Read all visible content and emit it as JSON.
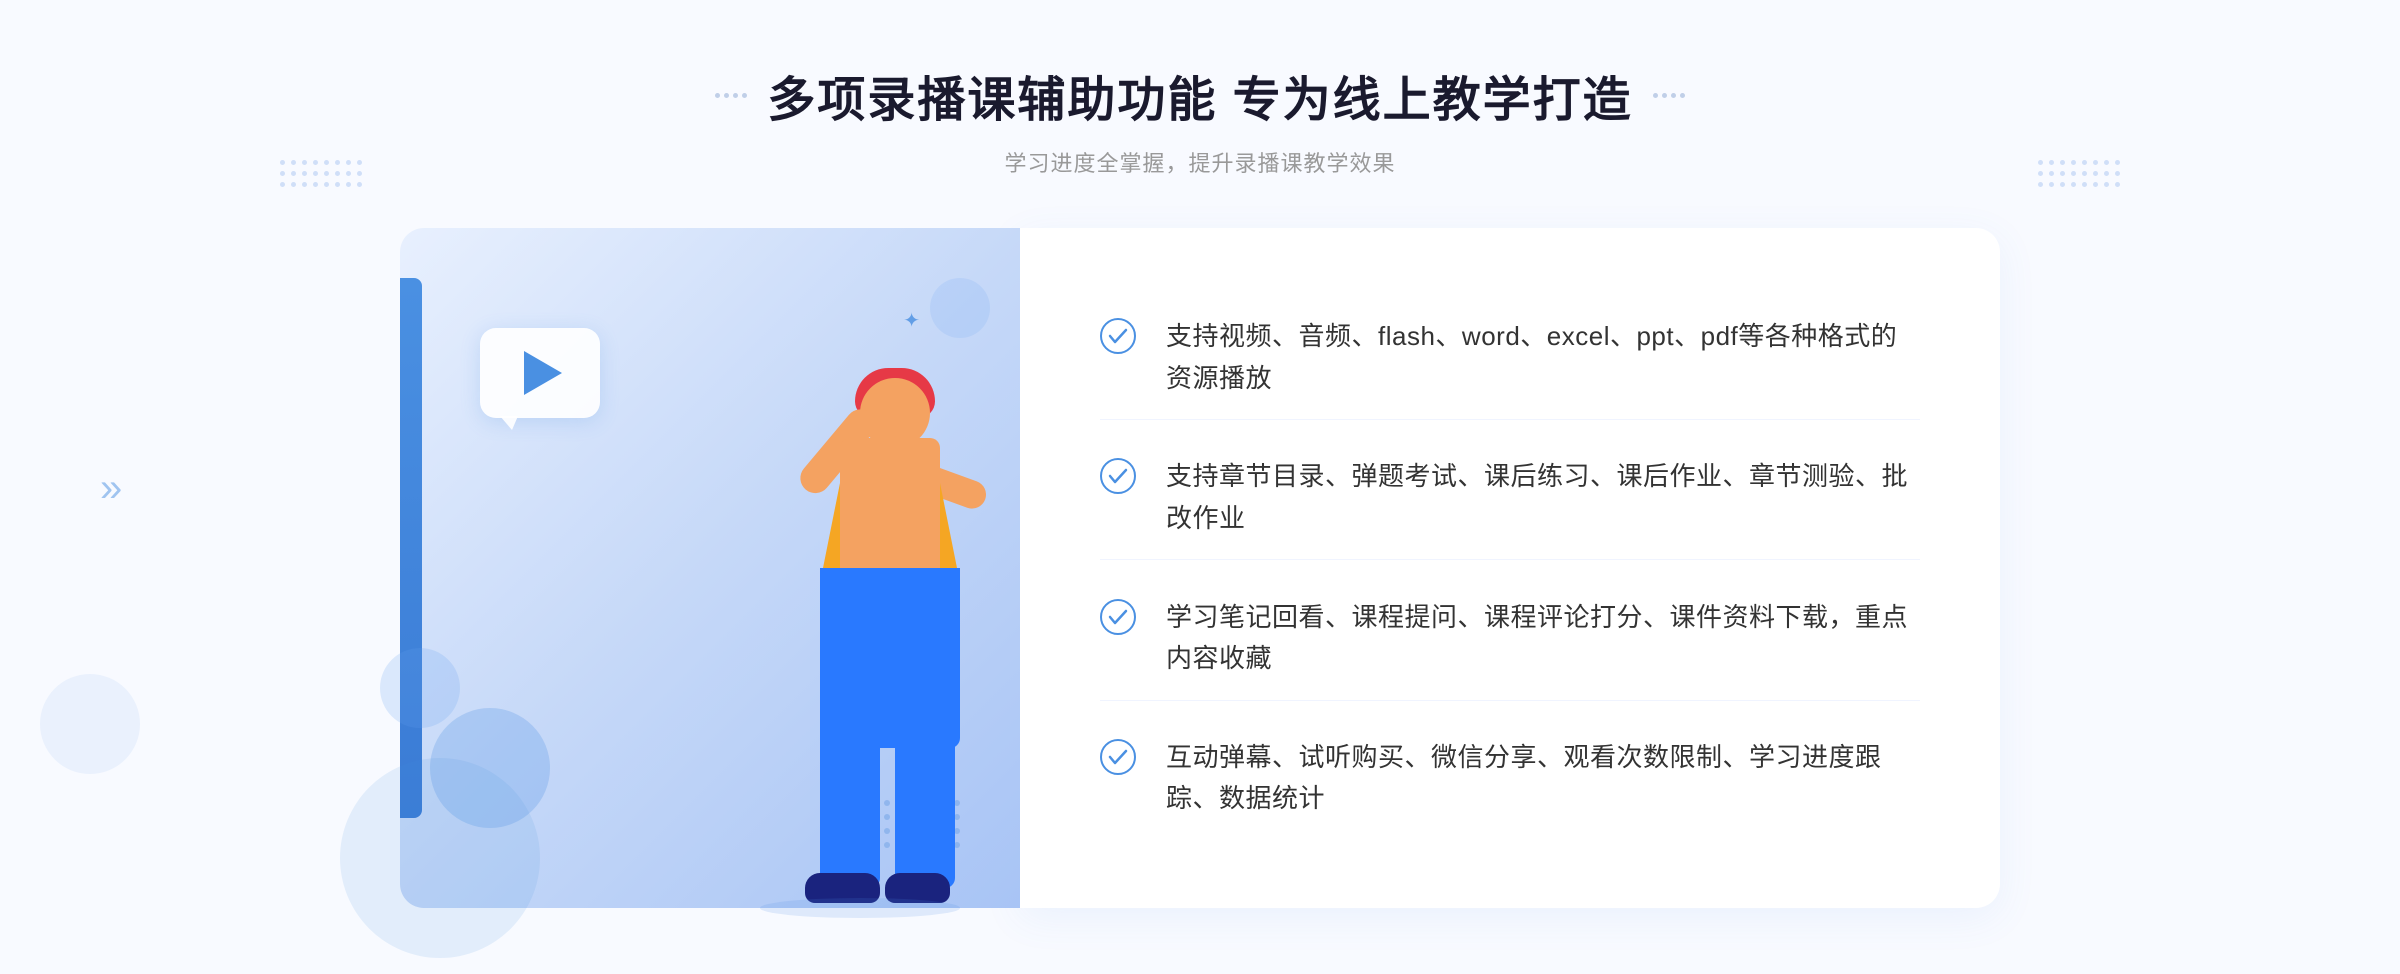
{
  "page": {
    "background": "#f8faff"
  },
  "header": {
    "title": "多项录播课辅助功能 专为线上教学打造",
    "subtitle": "学习进度全掌握，提升录播课教学效果"
  },
  "features": [
    {
      "id": 1,
      "text": "支持视频、音频、flash、word、excel、ppt、pdf等各种格式的资源播放"
    },
    {
      "id": 2,
      "text": "支持章节目录、弹题考试、课后练习、课后作业、章节测验、批改作业"
    },
    {
      "id": 3,
      "text": "学习笔记回看、课程提问、课程评论打分、课件资料下载，重点内容收藏"
    },
    {
      "id": 4,
      "text": "互动弹幕、试听购买、微信分享、观看次数限制、学习进度跟踪、数据统计"
    }
  ],
  "decorations": {
    "left_chevron": "»",
    "sparkle": "✦",
    "dots_count": 40
  }
}
